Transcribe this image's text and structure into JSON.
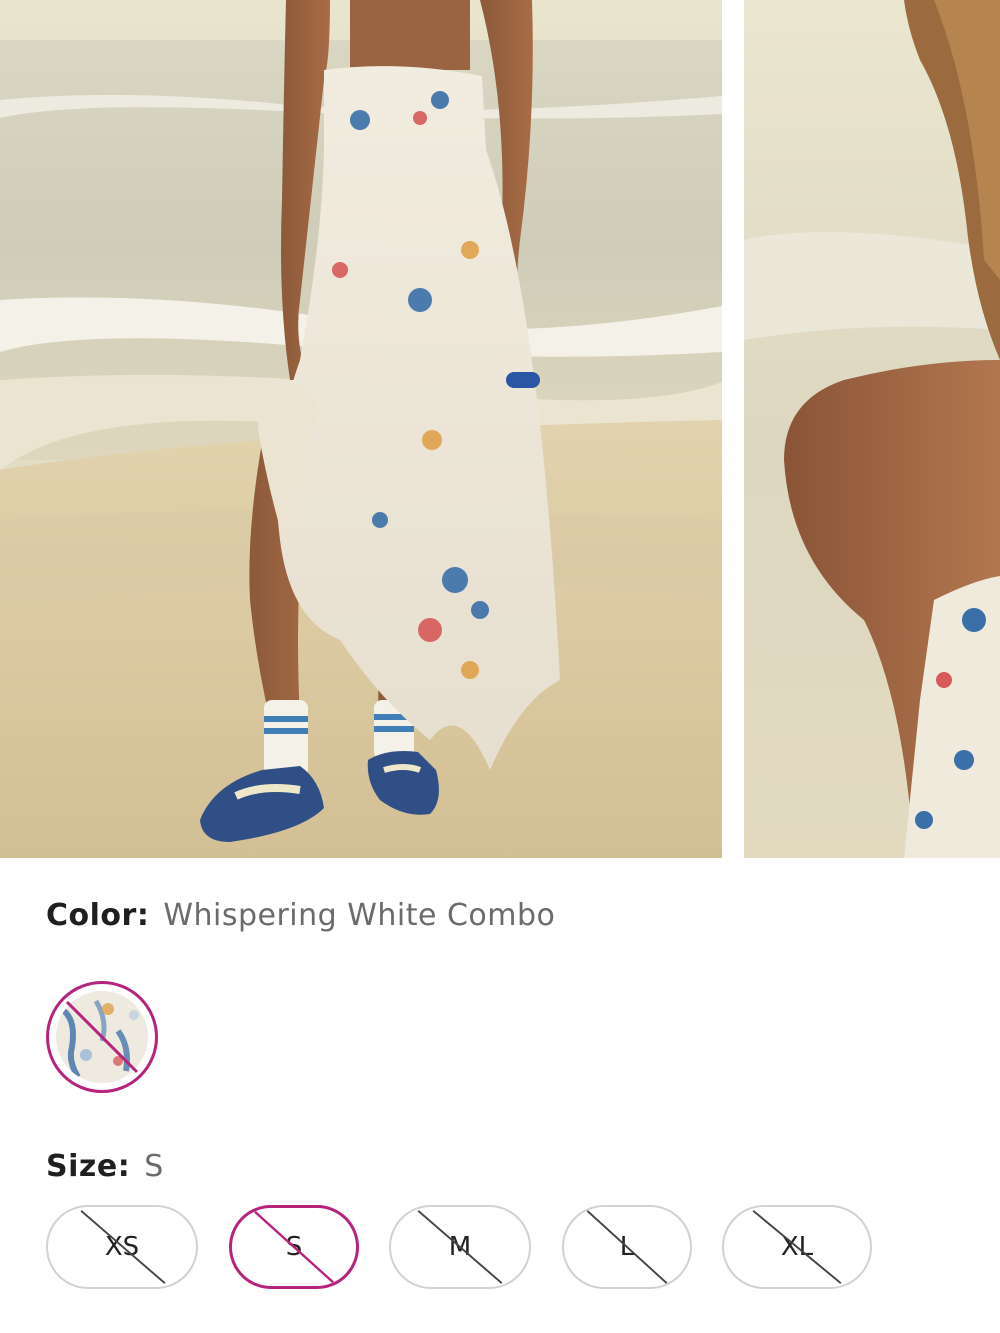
{
  "product_options": {
    "color": {
      "label": "Color:",
      "selected_value": "Whispering White Combo",
      "swatches": [
        {
          "name": "Whispering White Combo",
          "selected": true,
          "unavailable": true
        }
      ],
      "accent_color": "#b5237c"
    },
    "size": {
      "label": "Size:",
      "selected_value": "S",
      "options": [
        {
          "label": "XS",
          "selected": false,
          "unavailable": true
        },
        {
          "label": "S",
          "selected": true,
          "unavailable": true
        },
        {
          "label": "M",
          "selected": false,
          "unavailable": true
        },
        {
          "label": "L",
          "selected": false,
          "unavailable": true
        },
        {
          "label": "XL",
          "selected": false,
          "unavailable": true
        }
      ]
    }
  },
  "gallery": {
    "images": [
      {
        "alt_kind": "model-beach-full-dress"
      },
      {
        "alt_kind": "model-closeup-shoulder"
      }
    ]
  }
}
